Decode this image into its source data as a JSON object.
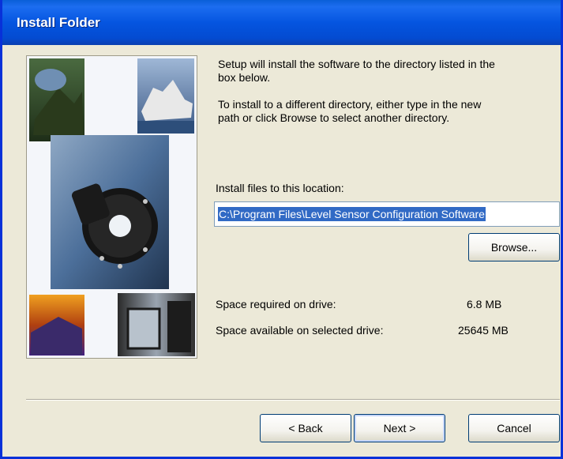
{
  "window": {
    "title": "Install Folder"
  },
  "intro": {
    "line1": "Setup will install the software to the directory listed in the",
    "line2": "box below.",
    "line3": "To install to a different directory, either type in the new",
    "line4": "path or click Browse to select another directory."
  },
  "location": {
    "label": "Install files to this location:",
    "path": "C:\\Program Files\\Level Sensor Configuration Software"
  },
  "buttons": {
    "browse": "Browse...",
    "back": "< Back",
    "next": "Next >",
    "cancel": "Cancel"
  },
  "space": {
    "required_label": "Space required on drive:",
    "required_value": "6.8 MB",
    "available_label": "Space available on selected drive:",
    "available_value": "25645 MB"
  }
}
